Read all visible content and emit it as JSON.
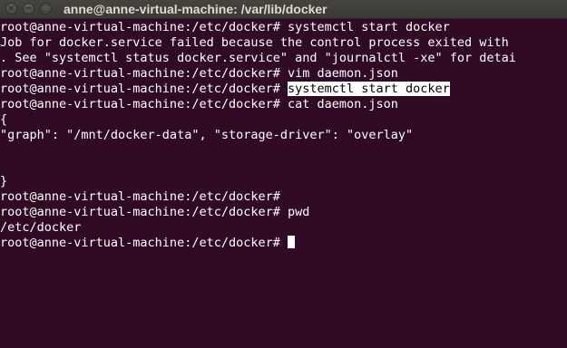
{
  "window": {
    "title": "anne@anne-virtual-machine: /var/lib/docker",
    "close_glyph": "×",
    "minimize_glyph": "−",
    "maximize_glyph": "□"
  },
  "terminal": {
    "background": "#300a24",
    "foreground": "#ffffff",
    "lines": [
      "root@anne-virtual-machine:/etc/docker# systemctl start docker",
      "Job for docker.service failed because the control process exited with",
      ". See \"systemctl status docker.service\" and \"journalctl -xe\" for detai",
      "root@anne-virtual-machine:/etc/docker# vim daemon.json",
      "root@anne-virtual-machine:/etc/docker# ",
      "root@anne-virtual-machine:/etc/docker# cat daemon.json",
      "{",
      "\"graph\": \"/mnt/docker-data\", \"storage-driver\": \"overlay\"",
      "",
      "",
      "}",
      "root@anne-virtual-machine:/etc/docker#",
      "root@anne-virtual-machine:/etc/docker# pwd",
      "/etc/docker",
      "root@anne-virtual-machine:/etc/docker# "
    ],
    "highlighted_command": "systemctl start docker"
  }
}
